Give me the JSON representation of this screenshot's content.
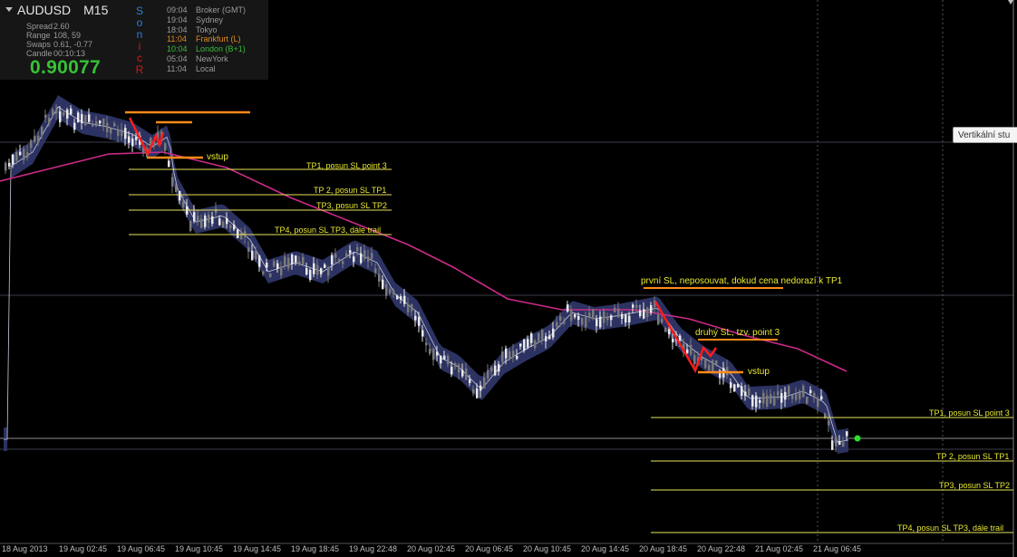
{
  "symbol": "AUDUSD",
  "timeframe": "M15",
  "stats": [
    {
      "label": "Spread",
      "value": "2.60"
    },
    {
      "label": "Range",
      "value": "108, 59"
    },
    {
      "label": "Swaps",
      "value": "0.61, -0.77"
    },
    {
      "label": "Candle",
      "value": "00:10:13"
    }
  ],
  "price": "0.90077",
  "sonic_letters": [
    {
      "ch": "S",
      "color": "#2f7fd8"
    },
    {
      "ch": "o",
      "color": "#2f7fd8"
    },
    {
      "ch": "n",
      "color": "#2f7fd8"
    },
    {
      "ch": "i",
      "color": "#c81e1e"
    },
    {
      "ch": "c",
      "color": "#c81e1e"
    },
    {
      "ch": "R",
      "color": "#c81e1e"
    }
  ],
  "sessions": [
    {
      "time": "09:04",
      "name": "Broker  (GMT)",
      "color": "#9a9a9a"
    },
    {
      "time": "19:04",
      "name": "Sydney",
      "color": "#9a9a9a"
    },
    {
      "time": "18:04",
      "name": "Tokyo",
      "color": "#9a9a9a"
    },
    {
      "time": "11:04",
      "name": "Frankfurt  (L)",
      "color": "#e08a1e"
    },
    {
      "time": "10:04",
      "name": "London  (B+1)",
      "color": "#38b838"
    },
    {
      "time": "05:04",
      "name": "NewYork",
      "color": "#9a9a9a"
    },
    {
      "time": "11:04",
      "name": "Local",
      "color": "#9a9a9a"
    }
  ],
  "tooltip": "Vertikální stu",
  "x_axis_labels": [
    "18 Aug 2013",
    "19 Aug 02:45",
    "19 Aug 06:45",
    "19 Aug 10:45",
    "19 Aug 14:45",
    "19 Aug 18:45",
    "19 Aug 22:48",
    "20 Aug 02:45",
    "20 Aug 06:45",
    "20 Aug 10:45",
    "20 Aug 14:45",
    "20 Aug 18:45",
    "20 Aug 22:48",
    "21 Aug 02:45",
    "21 Aug 06:45"
  ],
  "annotations": {
    "setup1": {
      "vstup": "vstup",
      "tp1": "TP1, posun SL point 3",
      "tp2": "TP 2, posun SL TP1",
      "tp3": "TP3, posun SL TP2",
      "tp4": "TP4, posun SL TP3, dále trail"
    },
    "setup2": {
      "first_sl": "první SL, neposouvat, dokud cena nedorazí k TP1",
      "second_sl": "druhý SL, tzv. point 3",
      "vstup": "vstup",
      "tp1": "TP1, posun SL point 3",
      "tp2": "TP 2, posun SL TP1",
      "tp3": "TP3, posun SL TP2",
      "tp4": "TP4, posun SL TP3, dále trail"
    }
  },
  "colors": {
    "background": "#000000",
    "bull_candle": "#e8e8e8",
    "bear_candle": "#7a7a7a",
    "band": "#2e3566",
    "band_mid": "#c9c9dc",
    "ma": "#cc2a8a",
    "tp_line": "#e7e35a",
    "sl_line": "#ff8a1a",
    "zigzag": "#ff1c1c",
    "price_dot": "#29e029",
    "grid": "#3b3b4a",
    "price_line": "#8c8c8c"
  }
}
